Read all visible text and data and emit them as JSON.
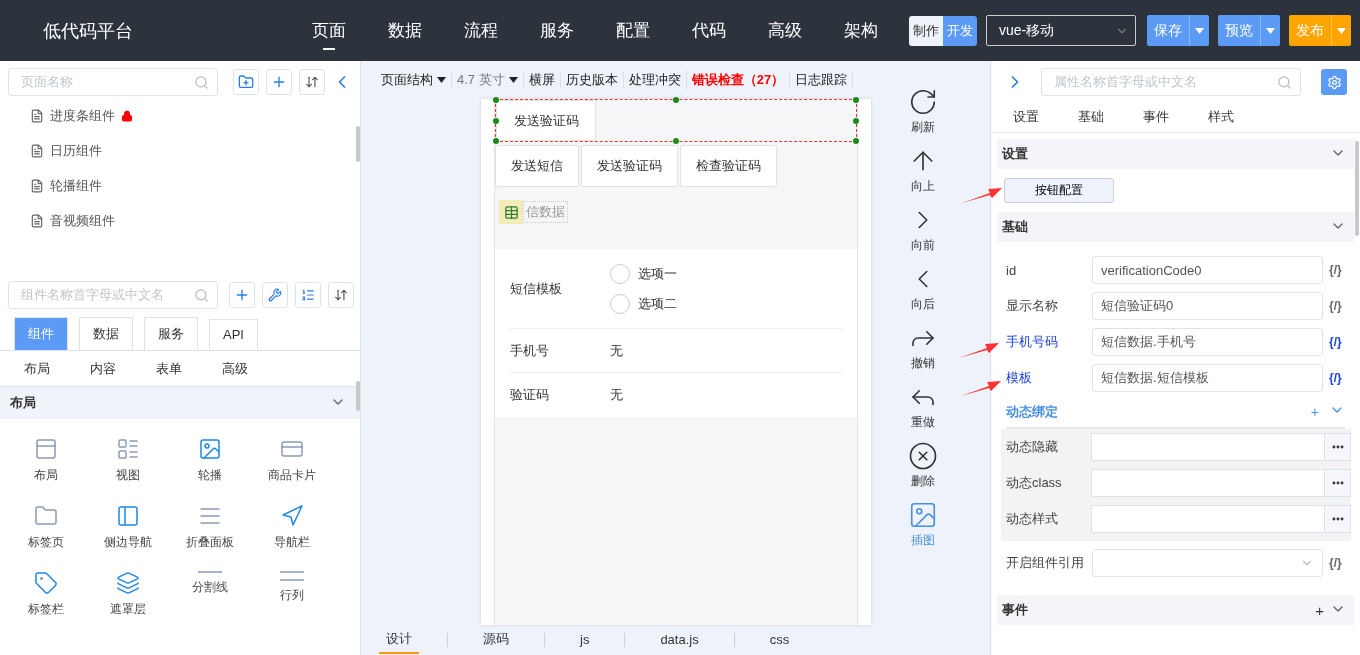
{
  "header": {
    "logo": "低代码平台",
    "nav": [
      {
        "label": "页面",
        "selected": true
      },
      {
        "label": "数据",
        "selected": false
      },
      {
        "label": "流程",
        "selected": false
      },
      {
        "label": "服务",
        "selected": false
      },
      {
        "label": "配置",
        "selected": false
      },
      {
        "label": "代码",
        "selected": false
      },
      {
        "label": "高级",
        "selected": false
      },
      {
        "label": "架构",
        "selected": false
      }
    ],
    "mode_toggle": [
      {
        "label": "制作",
        "selected": false
      },
      {
        "label": "开发",
        "selected": true
      }
    ],
    "template_select": {
      "value": "vue-移动"
    },
    "actions": [
      {
        "label": "保存",
        "color": "#5b9bf5"
      },
      {
        "label": "预览",
        "color": "#5b9bf5"
      },
      {
        "label": "发布",
        "color": "#ffa500"
      }
    ]
  },
  "left_panel": {
    "page_search": {
      "placeholder": "页面名称"
    },
    "page_tree": [
      {
        "label": "进度条组件",
        "locked": true
      },
      {
        "label": "日历组件",
        "locked": false
      },
      {
        "label": "轮播组件",
        "locked": false
      },
      {
        "label": "音视频组件",
        "locked": false
      }
    ],
    "component_search": {
      "placeholder": "组件名称首字母或中文名"
    },
    "source_tabs": [
      {
        "label": "组件",
        "selected": true
      },
      {
        "label": "数据",
        "selected": false
      },
      {
        "label": "服务",
        "selected": false
      },
      {
        "label": "API",
        "selected": false
      }
    ],
    "category_tabs": [
      {
        "label": "布局"
      },
      {
        "label": "内容"
      },
      {
        "label": "表单"
      },
      {
        "label": "高级"
      }
    ],
    "section": {
      "title": "布局",
      "expanded": true
    },
    "components": [
      {
        "label": "布局"
      },
      {
        "label": "视图"
      },
      {
        "label": "轮播"
      },
      {
        "label": "商品卡片"
      },
      {
        "label": "标签页"
      },
      {
        "label": "侧边导航"
      },
      {
        "label": "折叠面板"
      },
      {
        "label": "导航栏"
      },
      {
        "label": "标签栏"
      },
      {
        "label": "遮罩层"
      },
      {
        "label": "分割线"
      },
      {
        "label": "行列"
      }
    ]
  },
  "toolbar": [
    {
      "label": "页面结构",
      "kind": "dropdown"
    },
    {
      "label": "4.7 英寸",
      "kind": "dropdown"
    },
    {
      "label": "横屏",
      "kind": "plain"
    },
    {
      "label": "历史版本",
      "kind": "plain"
    },
    {
      "label": "处理冲突",
      "kind": "plain"
    },
    {
      "label": "错误检查（27）",
      "kind": "error"
    },
    {
      "label": "日志跟踪",
      "kind": "plain"
    }
  ],
  "canvas": {
    "selected_button": "发送验证码",
    "buttons": [
      "发送短信",
      "发送验证码",
      "检查验证码"
    ],
    "data_chip": "信数据",
    "form": [
      {
        "label": "短信模板",
        "kind": "radio",
        "options": [
          {
            "label": "选项一",
            "selected": false
          },
          {
            "label": "选项二",
            "selected": false
          }
        ]
      },
      {
        "label": "手机号",
        "kind": "text",
        "value": "无"
      },
      {
        "label": "验证码",
        "kind": "text",
        "value": "无"
      }
    ]
  },
  "side_tools": [
    {
      "label": "刷新",
      "selected": false
    },
    {
      "label": "向上",
      "selected": false
    },
    {
      "label": "向前",
      "selected": false
    },
    {
      "label": "向后",
      "selected": false
    },
    {
      "label": "撤销",
      "selected": false
    },
    {
      "label": "重做",
      "selected": false
    },
    {
      "label": "删除",
      "selected": false
    },
    {
      "label": "插图",
      "selected": true
    }
  ],
  "bottom_tabs": [
    {
      "label": "设计",
      "selected": true
    },
    {
      "label": "源码",
      "selected": false
    },
    {
      "label": "js",
      "selected": false
    },
    {
      "label": "data.js",
      "selected": false
    },
    {
      "label": "css",
      "selected": false
    }
  ],
  "right_panel": {
    "search": {
      "placeholder": "属性名称首字母或中文名"
    },
    "tabs": [
      {
        "label": "设置"
      },
      {
        "label": "基础"
      },
      {
        "label": "事件"
      },
      {
        "label": "样式"
      }
    ],
    "settings_section": {
      "title": "设置",
      "expanded": true,
      "button": "按钮配置"
    },
    "basic_section": {
      "title": "基础",
      "expanded": true,
      "fields": [
        {
          "label": "id",
          "value": "verificationCode0",
          "bind": "{/}",
          "bound": false
        },
        {
          "label": "显示名称",
          "value": "短信验证码0",
          "bind": "{/}",
          "bound": false
        },
        {
          "label": "手机号码",
          "value": "短信数据.手机号",
          "bind": "{/}",
          "bound": true
        },
        {
          "label": "模板",
          "value": "短信数据.短信模板",
          "bind": "{/}",
          "bound": true
        }
      ],
      "dynamic_group": {
        "title": "动态绑定",
        "add": "+",
        "expanded": true,
        "rows": [
          {
            "label": "动态隐藏"
          },
          {
            "label": "动态class"
          },
          {
            "label": "动态样式"
          }
        ]
      },
      "reference": {
        "label": "开启组件引用",
        "bind": "{/}"
      }
    },
    "events_section": {
      "title": "事件",
      "add": "+",
      "expanded": true
    }
  }
}
